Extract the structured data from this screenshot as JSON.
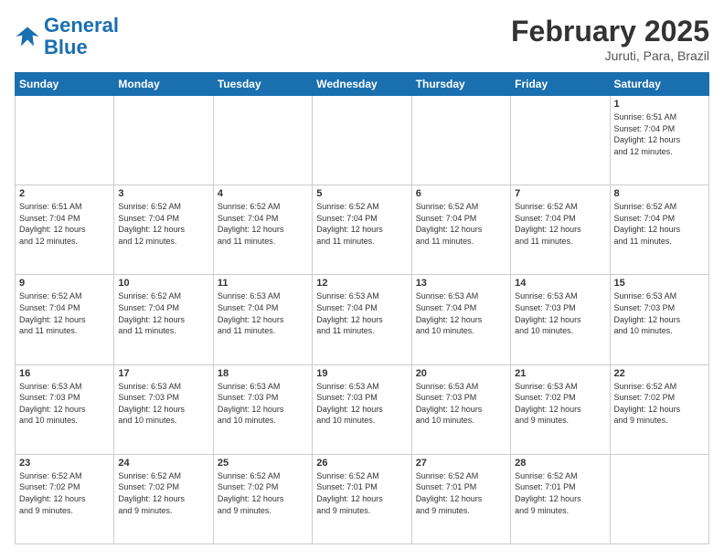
{
  "logo": {
    "line1": "General",
    "line2": "Blue"
  },
  "title": "February 2025",
  "subtitle": "Juruti, Para, Brazil",
  "days_of_week": [
    "Sunday",
    "Monday",
    "Tuesday",
    "Wednesday",
    "Thursday",
    "Friday",
    "Saturday"
  ],
  "weeks": [
    [
      {
        "day": "",
        "info": ""
      },
      {
        "day": "",
        "info": ""
      },
      {
        "day": "",
        "info": ""
      },
      {
        "day": "",
        "info": ""
      },
      {
        "day": "",
        "info": ""
      },
      {
        "day": "",
        "info": ""
      },
      {
        "day": "1",
        "info": "Sunrise: 6:51 AM\nSunset: 7:04 PM\nDaylight: 12 hours\nand 12 minutes."
      }
    ],
    [
      {
        "day": "2",
        "info": "Sunrise: 6:51 AM\nSunset: 7:04 PM\nDaylight: 12 hours\nand 12 minutes."
      },
      {
        "day": "3",
        "info": "Sunrise: 6:52 AM\nSunset: 7:04 PM\nDaylight: 12 hours\nand 12 minutes."
      },
      {
        "day": "4",
        "info": "Sunrise: 6:52 AM\nSunset: 7:04 PM\nDaylight: 12 hours\nand 11 minutes."
      },
      {
        "day": "5",
        "info": "Sunrise: 6:52 AM\nSunset: 7:04 PM\nDaylight: 12 hours\nand 11 minutes."
      },
      {
        "day": "6",
        "info": "Sunrise: 6:52 AM\nSunset: 7:04 PM\nDaylight: 12 hours\nand 11 minutes."
      },
      {
        "day": "7",
        "info": "Sunrise: 6:52 AM\nSunset: 7:04 PM\nDaylight: 12 hours\nand 11 minutes."
      },
      {
        "day": "8",
        "info": "Sunrise: 6:52 AM\nSunset: 7:04 PM\nDaylight: 12 hours\nand 11 minutes."
      }
    ],
    [
      {
        "day": "9",
        "info": "Sunrise: 6:52 AM\nSunset: 7:04 PM\nDaylight: 12 hours\nand 11 minutes."
      },
      {
        "day": "10",
        "info": "Sunrise: 6:52 AM\nSunset: 7:04 PM\nDaylight: 12 hours\nand 11 minutes."
      },
      {
        "day": "11",
        "info": "Sunrise: 6:53 AM\nSunset: 7:04 PM\nDaylight: 12 hours\nand 11 minutes."
      },
      {
        "day": "12",
        "info": "Sunrise: 6:53 AM\nSunset: 7:04 PM\nDaylight: 12 hours\nand 11 minutes."
      },
      {
        "day": "13",
        "info": "Sunrise: 6:53 AM\nSunset: 7:04 PM\nDaylight: 12 hours\nand 10 minutes."
      },
      {
        "day": "14",
        "info": "Sunrise: 6:53 AM\nSunset: 7:03 PM\nDaylight: 12 hours\nand 10 minutes."
      },
      {
        "day": "15",
        "info": "Sunrise: 6:53 AM\nSunset: 7:03 PM\nDaylight: 12 hours\nand 10 minutes."
      }
    ],
    [
      {
        "day": "16",
        "info": "Sunrise: 6:53 AM\nSunset: 7:03 PM\nDaylight: 12 hours\nand 10 minutes."
      },
      {
        "day": "17",
        "info": "Sunrise: 6:53 AM\nSunset: 7:03 PM\nDaylight: 12 hours\nand 10 minutes."
      },
      {
        "day": "18",
        "info": "Sunrise: 6:53 AM\nSunset: 7:03 PM\nDaylight: 12 hours\nand 10 minutes."
      },
      {
        "day": "19",
        "info": "Sunrise: 6:53 AM\nSunset: 7:03 PM\nDaylight: 12 hours\nand 10 minutes."
      },
      {
        "day": "20",
        "info": "Sunrise: 6:53 AM\nSunset: 7:03 PM\nDaylight: 12 hours\nand 10 minutes."
      },
      {
        "day": "21",
        "info": "Sunrise: 6:53 AM\nSunset: 7:02 PM\nDaylight: 12 hours\nand 9 minutes."
      },
      {
        "day": "22",
        "info": "Sunrise: 6:52 AM\nSunset: 7:02 PM\nDaylight: 12 hours\nand 9 minutes."
      }
    ],
    [
      {
        "day": "23",
        "info": "Sunrise: 6:52 AM\nSunset: 7:02 PM\nDaylight: 12 hours\nand 9 minutes."
      },
      {
        "day": "24",
        "info": "Sunrise: 6:52 AM\nSunset: 7:02 PM\nDaylight: 12 hours\nand 9 minutes."
      },
      {
        "day": "25",
        "info": "Sunrise: 6:52 AM\nSunset: 7:02 PM\nDaylight: 12 hours\nand 9 minutes."
      },
      {
        "day": "26",
        "info": "Sunrise: 6:52 AM\nSunset: 7:01 PM\nDaylight: 12 hours\nand 9 minutes."
      },
      {
        "day": "27",
        "info": "Sunrise: 6:52 AM\nSunset: 7:01 PM\nDaylight: 12 hours\nand 9 minutes."
      },
      {
        "day": "28",
        "info": "Sunrise: 6:52 AM\nSunset: 7:01 PM\nDaylight: 12 hours\nand 9 minutes."
      },
      {
        "day": "",
        "info": ""
      }
    ]
  ]
}
